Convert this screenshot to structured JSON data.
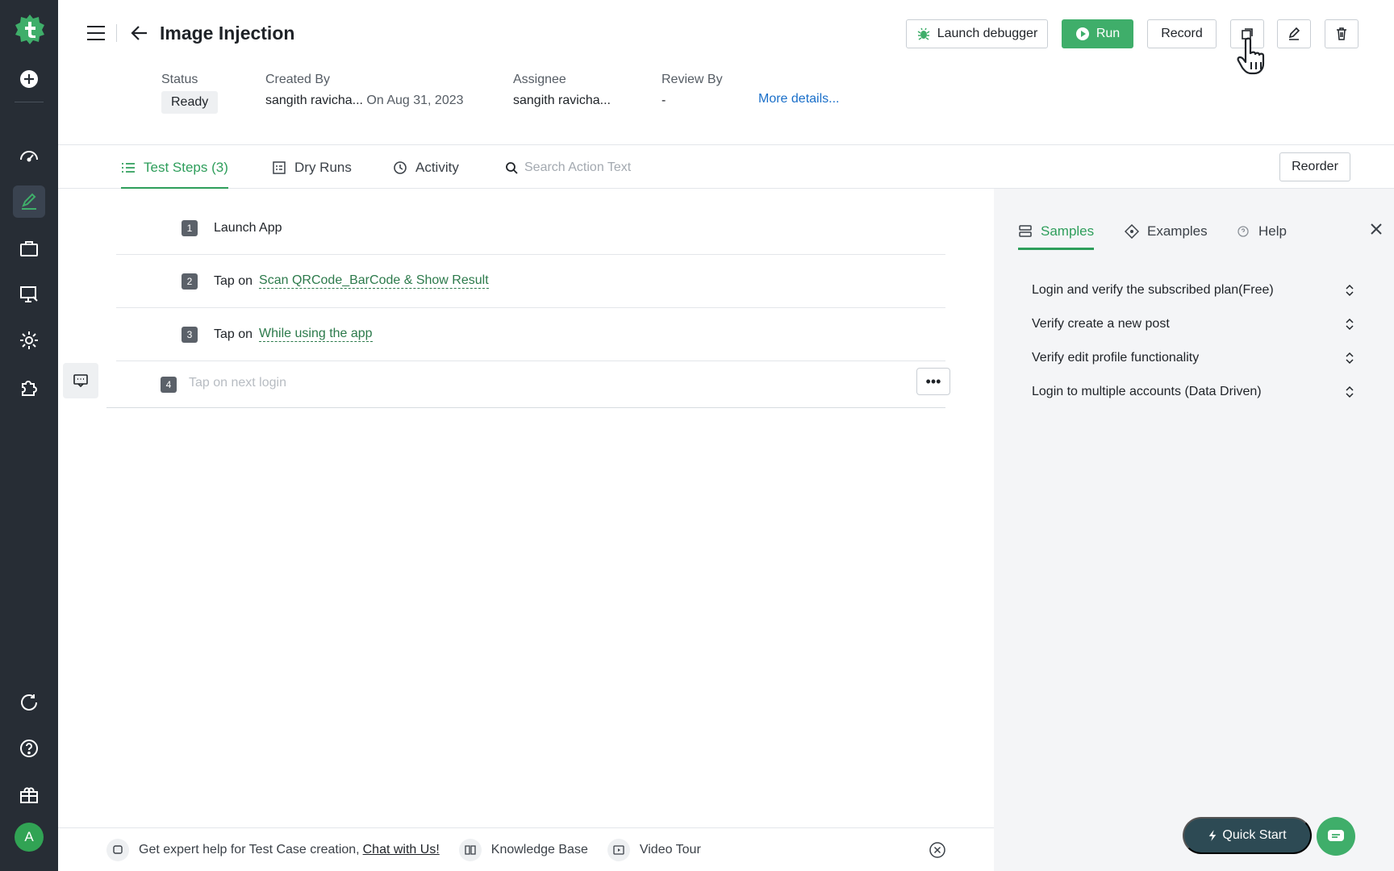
{
  "sidebar": {
    "avatar_initial": "A",
    "items": [
      "add-icon",
      "dashboard-icon",
      "test-cases-icon",
      "briefcase-icon",
      "monitor-icon",
      "settings-icon",
      "puzzle-icon",
      "refresh-icon",
      "help-icon",
      "gift-icon"
    ]
  },
  "header": {
    "title": "Image Injection",
    "buttons": {
      "launch_debugger": "Launch debugger",
      "run": "Run",
      "record": "Record"
    },
    "meta": {
      "status_label": "Status",
      "status_value": "Ready",
      "created_by_label": "Created By",
      "created_by_value": "sangith ravicha...",
      "created_on": "On Aug 31, 2023",
      "assignee_label": "Assignee",
      "assignee_value": "sangith ravicha...",
      "review_by_label": "Review By",
      "review_by_value": "-",
      "more_details": "More details..."
    }
  },
  "tabs": {
    "test_steps": "Test Steps (3)",
    "dry_runs": "Dry Runs",
    "activity": "Activity",
    "search_placeholder": "Search Action Text",
    "reorder": "Reorder"
  },
  "steps": [
    {
      "num": "1",
      "text": "Launch App",
      "element": ""
    },
    {
      "num": "2",
      "text": "Tap on",
      "element": "Scan QRCode_BarCode & Show Result"
    },
    {
      "num": "3",
      "text": "Tap on",
      "element": "While using the app"
    }
  ],
  "new_step": {
    "num": "4",
    "placeholder": "Tap on next login",
    "more": "•••"
  },
  "panel": {
    "tabs": {
      "samples": "Samples",
      "examples": "Examples",
      "help": "Help"
    },
    "samples": [
      "Login and verify the subscribed plan(Free)",
      "Verify create a new post",
      "Verify edit profile functionality",
      "Login to multiple accounts (Data Driven)"
    ]
  },
  "footer": {
    "help_text": "Get expert help for Test Case creation,",
    "chat_link": "Chat with Us!",
    "knowledge_base": "Knowledge Base",
    "video_tour": "Video Tour"
  },
  "quick_start": "Quick Start",
  "colors": {
    "sidebar_bg": "#272d35",
    "accent": "#2e9e5b",
    "run_button": "#3fae6a",
    "link": "#1a6fc9",
    "quick_start_bg": "#2d4a54"
  }
}
